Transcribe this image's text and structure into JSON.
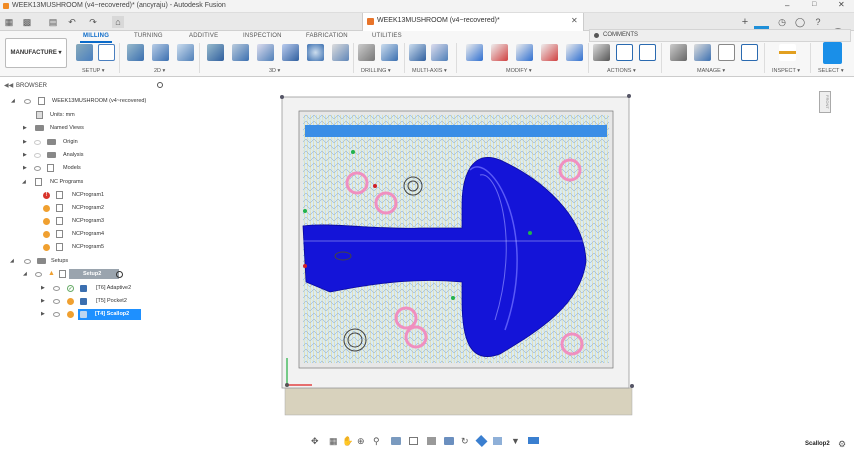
{
  "app": {
    "title": "WEEK13MUSHROOM (v4~recovered)* (ancyraju) - Autodesk Fusion"
  },
  "document_tab": {
    "label": "WEEK13MUSHROOM (v4~recovered)*"
  },
  "workspace": {
    "label": "MANUFACTURE ▾"
  },
  "ribbon": {
    "tabs": [
      "MILLING",
      "TURNING",
      "ADDITIVE",
      "INSPECTION",
      "FABRICATION",
      "UTILITIES"
    ],
    "active_tab": "MILLING",
    "groups": [
      "SETUP ▾",
      "2D ▾",
      "3D ▾",
      "DRILLING ▾",
      "MULTI-AXIS ▾",
      "MODIFY ▾",
      "ACTIONS ▾",
      "MANAGE ▾",
      "INSPECT ▾",
      "SELECT ▾"
    ]
  },
  "comments": {
    "label": "COMMENTS"
  },
  "browser": {
    "title": "BROWSER",
    "root": "WEEK13MUSHROOM (v4~recovered)",
    "units": "Units: mm",
    "named_views": "Named Views",
    "origin": "Origin",
    "analysis": "Analysis",
    "models": "Models",
    "nc_programs": "NC Programs",
    "nc_items": [
      "NCProgram1",
      "NCProgram2",
      "NCProgram3",
      "NCProgram4",
      "NCProgram5"
    ],
    "setups": "Setups",
    "setup2": "Setup2",
    "ops": [
      "[T6] Adaptive2",
      "[T5] Pocket2",
      "[T4] Scallop2"
    ]
  },
  "viewcube": {
    "label": "FRONT"
  },
  "status": {
    "selected_operation": "Scallop2"
  },
  "colors": {
    "accent": "#0a6ac9",
    "selected": "#1e90ff",
    "toolpath_blue": "#1414d8",
    "stock_tan": "#d8d2bd"
  }
}
